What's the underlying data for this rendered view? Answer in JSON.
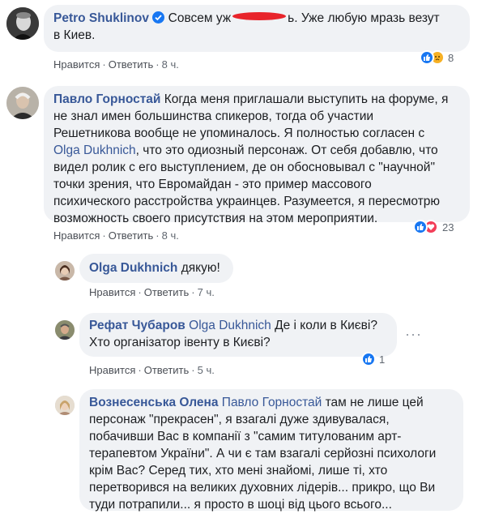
{
  "comments": [
    {
      "author": "Petro Shuklinov",
      "verified": true,
      "text_before": "Совсем уж",
      "text_after": "ь. Уже любую мразь везут",
      "text_line2": "в Киев.",
      "like_label": "Нравится",
      "reply_label": "Ответить",
      "time": "8 ч.",
      "reaction_count": "8",
      "reactions": [
        "like-icon",
        "sad-icon"
      ]
    },
    {
      "author": "Павло Горностай",
      "lines": [
        "Когда меня приглашали выступить на форуме, я",
        "не знал имен большинства спикеров, тогда об участии",
        "Решетникова вообще не упоминалось. Я полностью согласен с"
      ],
      "mention": "Olga Dukhnich",
      "line4_after": ", что это одиозный персонаж. От себя добавлю, что",
      "lines_rest": [
        "видел ролик с его выступлением, де он обосновывал с \"научной\"",
        "точки зрения, что Евромайдан - это пример массового",
        "психического расстройства украинцев. Разумеется, я пересмотрю",
        "возможность своего присутствия на этом мероприятии."
      ],
      "like_label": "Нравится",
      "reply_label": "Ответить",
      "time": "8 ч.",
      "reaction_count": "23",
      "reactions": [
        "like-icon",
        "love-icon"
      ]
    },
    {
      "author": "Olga Dukhnich",
      "text": "дякую!",
      "like_label": "Нравится",
      "reply_label": "Ответить",
      "time": "7 ч."
    },
    {
      "author": "Рефат Чубаров",
      "mention": "Olga Dukhnich",
      "text_line1": "Де і коли в Києві?",
      "text_line2": "Хто організатор івенту в Києві?",
      "like_label": "Нравится",
      "reply_label": "Ответить",
      "time": "5 ч.",
      "reaction_count": "1",
      "reactions": [
        "like-icon"
      ]
    },
    {
      "author": "Вознесенська Олена",
      "mention": "Павло Горностай",
      "line1_after": "там не лише цей",
      "lines": [
        "персонаж \"прекрасен\", я взагалі дуже здивувалася,",
        "побачивши Вас в компанії з \"самим титулованим арт-",
        "терапевтом України\". А чи є там взагалі серйозні психологи",
        "крім Вас? Серед тих, хто мені знайомі, лише ті, хто",
        "перетворився на великих духовних лідерів... прикро, що Ви",
        "туди потрапили... я просто в шоці від цього всього..."
      ]
    }
  ],
  "separator": "·",
  "colors": {
    "link": "#385898",
    "bubble": "#f0f2f5",
    "like": "#1877f2",
    "love": "#f33e58",
    "sad": "#f7b125"
  }
}
